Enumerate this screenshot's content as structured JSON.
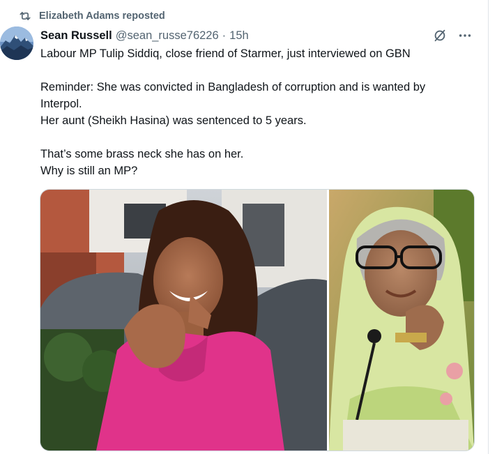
{
  "repost": {
    "icon": "repost-icon",
    "text": "Elizabeth Adams reposted"
  },
  "post": {
    "avatar_icon": "mountain-avatar",
    "display_name": "Sean Russell",
    "handle": "@sean_russe76226",
    "separator": "·",
    "time": "15h",
    "actions": [
      {
        "icon": "grok-slash-icon"
      },
      {
        "icon": "more-options-icon"
      }
    ],
    "text_lines": [
      "Labour MP Tulip Siddiq, close friend of Starmer, just interviewed on GBN",
      "Reminder: She was convicted in Bangladesh of corruption and is wanted by",
      "Interpol.",
      "Her aunt (Sheikh Hasina) was sentenced to 5 years.",
      "That’s some brass neck she has on her.",
      "Why is still an MP?"
    ],
    "media": [
      {
        "kind": "photo",
        "subject": "woman-in-pink-jacket"
      },
      {
        "kind": "photo",
        "subject": "older-woman-in-green-sari"
      }
    ]
  },
  "colors": {
    "text_primary": "#0f1419",
    "text_secondary": "#536471",
    "divider": "#dfe4e8",
    "pink_jacket": "#e0338a",
    "sari_green": "#d8e6a2"
  }
}
